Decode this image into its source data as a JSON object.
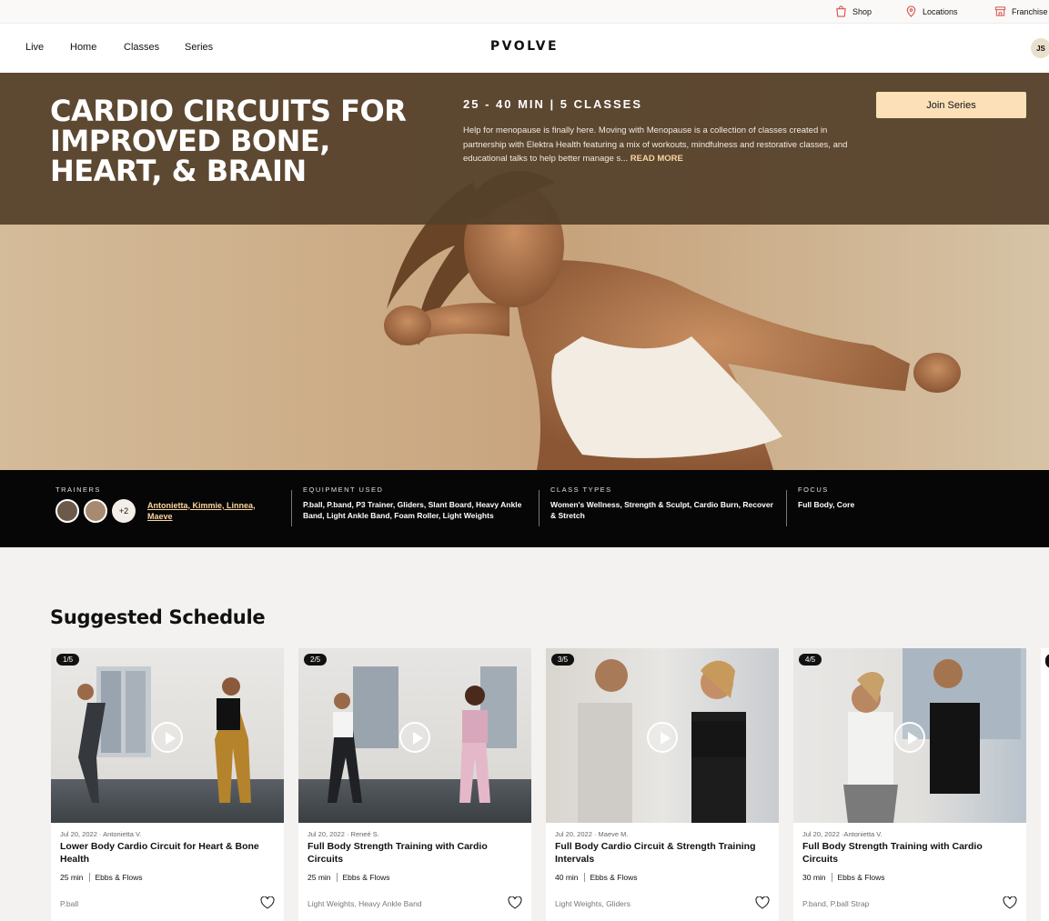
{
  "utility_nav": {
    "shop": "Shop",
    "locations": "Locations",
    "franchise": "Franchise"
  },
  "nav": {
    "links": [
      "Live",
      "Home",
      "Classes",
      "Series"
    ],
    "logo": "PVOLVE",
    "user_initials": "JS"
  },
  "hero": {
    "title": "Cardio Circuits for Improved Bone, Heart, & Brain",
    "meta": "25 - 40 MIN  |  5 CLASSES",
    "description": "Help for menopause is finally here. Moving with Menopause is a collection of classes created in partnership with Elektra Health featuring a mix of workouts, mindfulness and restorative classes, and educational talks to help better manage s...",
    "read_more": "READ MORE",
    "join_button": "Join Series"
  },
  "info": {
    "trainers_label": "TRAINERS",
    "trainers_more": "+2",
    "trainers_names": "Antonietta, Kimmie, Linnea, Maeve",
    "equipment_label": "EQUIPMENT USED",
    "equipment": "P.ball, P.band, P3 Trainer, Gliders, Slant Board, Heavy Ankle Band, Light Ankle Band, Foam Roller, Light Weights",
    "class_types_label": "CLASS TYPES",
    "class_types": "Women's Wellness, Strength & Sculpt, Cardio Burn, Recover & Stretch",
    "focus_label": "FOCUS",
    "focus": "Full Body, Core"
  },
  "schedule": {
    "title": "Suggested Schedule",
    "cards": [
      {
        "badge": "1/5",
        "date": "Jul 20, 2022 · Antonietta V.",
        "title": "Lower Body Cardio Circuit for Heart & Bone Health",
        "duration": "25 min",
        "category": "Ebbs & Flows",
        "equipment": "P.ball"
      },
      {
        "badge": "2/5",
        "date": "Jul 20, 2022 · Reneé S.",
        "title": "Full Body Strength Training with Cardio Circuits",
        "duration": "25 min",
        "category": "Ebbs & Flows",
        "equipment": "Light Weights, Heavy Ankle Band"
      },
      {
        "badge": "3/5",
        "date": "Jul 20, 2022 · Maeve M.",
        "title": "Full Body Cardio Circuit & Strength Training Intervals",
        "duration": "40 min",
        "category": "Ebbs & Flows",
        "equipment": "Light Weights, Gliders"
      },
      {
        "badge": "4/5",
        "date": "Jul 20, 2022 ·Antonietta V.",
        "title": "Full Body Strength Training with Cardio Circuits",
        "duration": "30 min",
        "category": "Ebbs & Flows",
        "equipment": "P.band, P.ball Strap"
      }
    ]
  },
  "colors": {
    "banner": "#54402a",
    "accent": "#fbe0b8",
    "link_gold": "#fbd5a0",
    "strip": "#060606"
  }
}
